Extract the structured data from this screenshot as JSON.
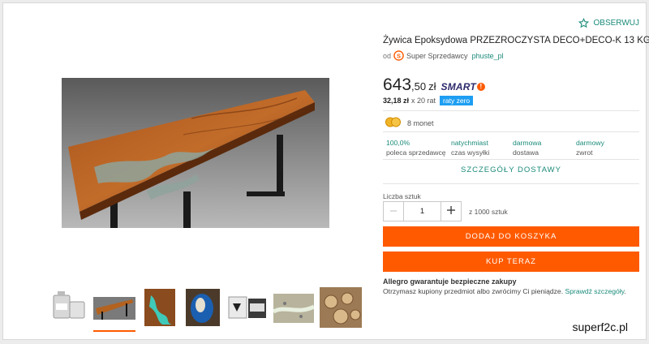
{
  "follow": {
    "label": "OBSERWUJ",
    "icon": "star-outline-icon"
  },
  "product": {
    "title": "Żywica Epoksydowa PRZEZROCZYSTA DECO+DECO-K 13 KG"
  },
  "seller": {
    "prefix": "od",
    "badge_icon": "super-seller-icon",
    "badge_label": "Super Sprzedawcy",
    "name": "phuste_pl"
  },
  "price": {
    "integer": "643",
    "decimal": ",50",
    "currency": "zł",
    "smart_label": "SMART",
    "smart_mark": "!"
  },
  "installment": {
    "amount": "32,18 zł",
    "times": "x 20 rat",
    "badge": "raty zero"
  },
  "coins": {
    "label": "8 monet",
    "icon": "coin-icon"
  },
  "stats": [
    {
      "value": "100,0%",
      "label": "poleca sprzedawcę"
    },
    {
      "value": "natychmiast",
      "label": "czas wysyłki"
    },
    {
      "value": "darmowa",
      "label": "dostawa"
    },
    {
      "value": "darmowy",
      "label": "zwrot"
    }
  ],
  "delivery_details": "SZCZEGÓŁY DOSTAWY",
  "quantity": {
    "label": "Liczba sztuk",
    "value": "1",
    "of": "z 1000 sztuk",
    "minus_icon": "minus-icon",
    "plus_icon": "plus-icon"
  },
  "buttons": {
    "add_to_cart": "DODAJ DO KOSZYKA",
    "buy_now": "KUP TERAZ"
  },
  "guarantee": {
    "title": "Allegro gwarantuje bezpieczne zakupy",
    "text": "Otrzymasz kupiony przedmiot albo zwrócimy Ci pieniądze. ",
    "link": "Sprawdź szczegóły",
    "end": "."
  },
  "watermark": "superf2c.pl",
  "colors": {
    "accent": "#ff5a00",
    "link": "#1b8b7a",
    "raty_badge": "#1e9ef2",
    "smart": "#2d2a6b"
  }
}
